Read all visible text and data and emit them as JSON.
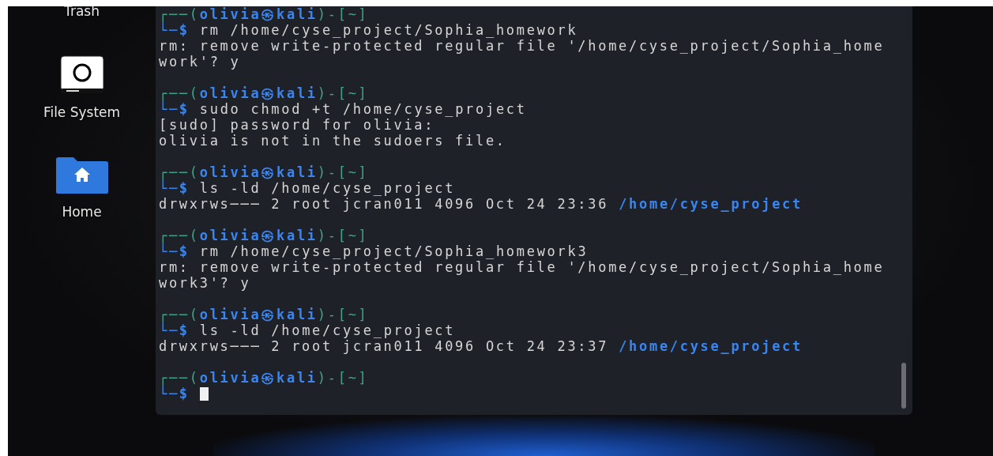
{
  "desktop_icons": [
    {
      "label": "Trash",
      "kind": "trash"
    },
    {
      "label": "File System",
      "kind": "drive"
    },
    {
      "label": "Home",
      "kind": "home"
    }
  ],
  "terminal": {
    "blocks": [
      {
        "prompt": {
          "frame_start": "┌──(",
          "user_host": "olivia㉿kali",
          "frame_mid": ")-[",
          "dir": "~",
          "frame_end": "]"
        },
        "lead": "└─$",
        "command": "rm /home/cyse_project/Sophia_homework",
        "kind": "history",
        "output": [
          {
            "text": "rm: remove write-protected regular file '/home/cyse_project/Sophia_home"
          },
          {
            "text": "work'? y"
          }
        ]
      },
      {
        "prompt": {
          "frame_start": "┌──(",
          "user_host": "olivia㉿kali",
          "frame_mid": ")-[",
          "dir": "~",
          "frame_end": "]"
        },
        "lead": "└─$",
        "command": "sudo chmod +t /home/cyse_project",
        "kind": "history",
        "output": [
          {
            "text": "[sudo] password for olivia:"
          },
          {
            "text": "olivia is not in the sudoers file."
          }
        ]
      },
      {
        "prompt": {
          "frame_start": "┌──(",
          "user_host": "olivia㉿kali",
          "frame_mid": ")-[",
          "dir": "~",
          "frame_end": "]"
        },
        "lead": "└─$",
        "command": "ls -ld /home/cyse_project",
        "kind": "history",
        "output": [
          {
            "text": "drwxrws─── 2 root jcran011 4096 Oct 24 23:36",
            "path": "/home/cyse_project"
          }
        ]
      },
      {
        "prompt": {
          "frame_start": "┌──(",
          "user_host": "olivia㉿kali",
          "frame_mid": ")-[",
          "dir": "~",
          "frame_end": "]"
        },
        "lead": "└─$",
        "command": "rm /home/cyse_project/Sophia_homework3",
        "kind": "history",
        "output": [
          {
            "text": "rm: remove write-protected regular file '/home/cyse_project/Sophia_home"
          },
          {
            "text": "work3'? y"
          }
        ]
      },
      {
        "prompt": {
          "frame_start": "┌──(",
          "user_host": "olivia㉿kali",
          "frame_mid": ")-[",
          "dir": "~",
          "frame_end": "]"
        },
        "lead": "└─$",
        "command": "ls -ld /home/cyse_project",
        "kind": "history",
        "output": [
          {
            "text": "drwxrws─── 2 root jcran011 4096 Oct 24 23:37",
            "path": "/home/cyse_project"
          }
        ]
      },
      {
        "prompt": {
          "frame_start": "┌──(",
          "user_host": "olivia㉿kali",
          "frame_mid": ")-[",
          "dir": "~",
          "frame_end": "]"
        },
        "lead": "└─$",
        "kind": "active"
      }
    ]
  }
}
